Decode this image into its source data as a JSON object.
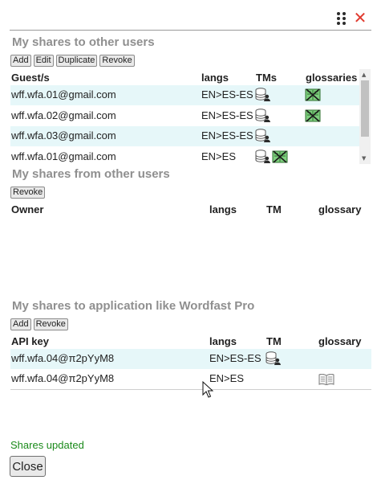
{
  "dialog": {
    "close_symbol": "✕"
  },
  "shares_to_users": {
    "title": "My shares to other users",
    "buttons": {
      "add": "Add",
      "edit": "Edit",
      "duplicate": "Duplicate",
      "revoke": "Revoke"
    },
    "headers": {
      "guest": "Guest/s",
      "langs": "langs",
      "tms": "TMs",
      "glossaries": "glossaries"
    },
    "rows": [
      {
        "guest": "wff.wfa.01@gmail.com",
        "langs": "EN>ES-ES",
        "tm_icon": "database-user-icon",
        "glossary_icon": "glossary-shared-icon"
      },
      {
        "guest": "wff.wfa.02@gmail.com",
        "langs": "EN>ES-ES",
        "tm_icon": "database-user-icon",
        "glossary_icon": "glossary-shared-icon"
      },
      {
        "guest": "wff.wfa.03@gmail.com",
        "langs": "EN>ES-ES",
        "tm_icon": "database-user-icon"
      },
      {
        "guest": "wff.wfa.01@gmail.com",
        "langs": "EN>ES",
        "tm_icon": "database-user-icon",
        "glossary_icon": "glossary-shared-icon"
      }
    ]
  },
  "shares_from_users": {
    "title": "My shares from other users",
    "buttons": {
      "revoke": "Revoke"
    },
    "headers": {
      "owner": "Owner",
      "langs": "langs",
      "tm": "TM",
      "glossary": "glossary"
    }
  },
  "shares_to_apps": {
    "title": "My shares to application like Wordfast Pro",
    "buttons": {
      "add": "Add",
      "revoke": "Revoke"
    },
    "headers": {
      "api_key": "API key",
      "langs": "langs",
      "tm": "TM",
      "glossary": "glossary"
    },
    "rows": [
      {
        "api_key": "wff.wfa.04@π2pYyM8",
        "langs": "EN>ES-ES",
        "tm_icon": "database-user-icon"
      },
      {
        "api_key": "wff.wfa.04@π2pYyM8",
        "langs": "EN>ES",
        "glossary_icon": "open-book-icon"
      }
    ]
  },
  "status": {
    "message": "Shares updated",
    "color": "#1a8a1a"
  },
  "footer": {
    "close_label": "Close"
  },
  "colors": {
    "accent_close": "#e03a2f",
    "row_highlight": "#e6f7f9",
    "section_title": "#8f8f8f"
  }
}
